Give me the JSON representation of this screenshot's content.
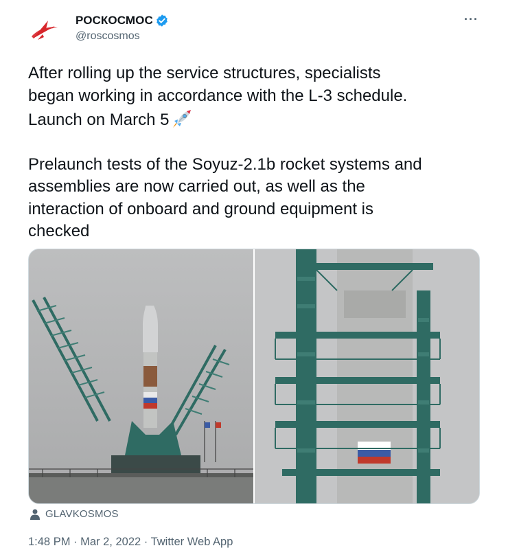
{
  "tweet": {
    "author": {
      "display_name": "РОСКОСМОС",
      "handle": "@roscosmos",
      "verified": true
    },
    "text_para1": "After rolling up the service structures, specialists\nbegan working in accordance with the L-3 schedule.\nLaunch on March 5",
    "text_para2": "Prelaunch tests of the Soyuz-2.1b rocket systems and\nassemblies are now carried out, as well as the\ninteraction of onboard and ground equipment is\nchecked",
    "emoji": "rocket",
    "media": {
      "photo_credit": "GLAVKOSMOS"
    },
    "metadata": {
      "time": "1:48 PM",
      "separator": " · ",
      "date": "Mar 2, 2022",
      "source": "Twitter Web App"
    },
    "more_label": "···"
  },
  "colors": {
    "text_primary": "#0f1419",
    "text_secondary": "#536471",
    "verified_blue": "#1d9bf0",
    "logo_red": "#d7262b"
  }
}
